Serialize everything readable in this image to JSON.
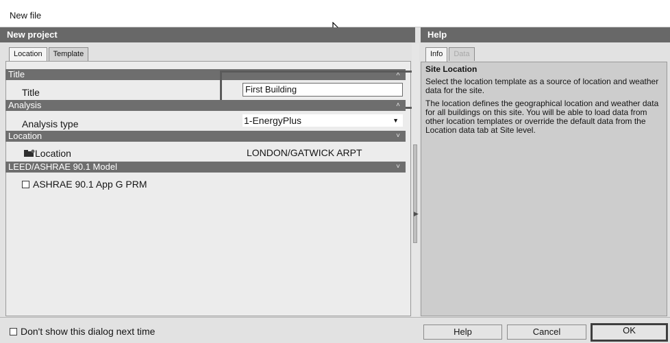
{
  "window": {
    "title": "New file"
  },
  "left_header": "New project",
  "right_header": "Help",
  "left_tabs": [
    {
      "label": "Location"
    },
    {
      "label": "Template"
    }
  ],
  "right_tabs": [
    {
      "label": "Info"
    },
    {
      "label": "Data"
    }
  ],
  "sections": {
    "title": "Title",
    "analysis": "Analysis",
    "location": "Location",
    "leed": "LEED/ASHRAE 90.1 Model"
  },
  "props": {
    "title_label": "Title",
    "title_value": "First Building",
    "analysis_type_label": "Analysis type",
    "analysis_type_value": "1-EnergyPlus",
    "location_label": "Location",
    "location_value": "LONDON/GATWICK ARPT",
    "ashrae_label": "ASHRAE 90.1 App G PRM"
  },
  "help": {
    "heading": "Site Location",
    "p1": "Select the location template as a source of location and weather data for the site.",
    "p2": "The location defines the geographical location and weather data for all buildings on this site.  You will be able to load data from other location templates or override the default data from the Location data tab at Site level."
  },
  "footer": {
    "dont_show": "Don't show this dialog next time",
    "help_btn": "Help",
    "cancel_btn": "Cancel",
    "ok_btn": "OK"
  },
  "icons": {
    "cursor": "mouse-pointer-icon",
    "collapse": "chevron-up-double-icon",
    "dropdown": "dropdown-arrow-icon",
    "location": "location-folder-icon",
    "splitter": "splitter-arrow-icon"
  }
}
